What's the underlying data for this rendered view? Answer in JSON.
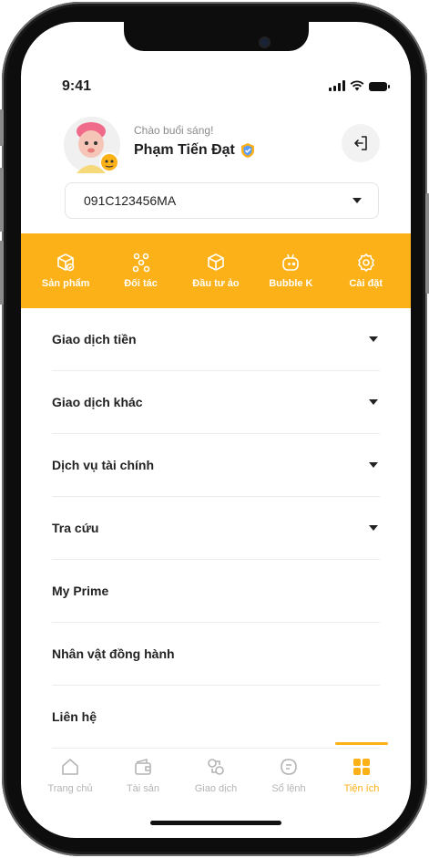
{
  "status_bar": {
    "time": "9:41"
  },
  "profile": {
    "greeting": "Chào buổi sáng!",
    "name": "Phạm Tiến Đạt"
  },
  "account": {
    "selected": "091C123456MA"
  },
  "quick_actions": [
    {
      "label": "Sản phẩm",
      "icon": "package-icon"
    },
    {
      "label": "Đối tác",
      "icon": "network-icon"
    },
    {
      "label": "Đầu tư ảo",
      "icon": "box-icon"
    },
    {
      "label": "Bubble K",
      "icon": "gamepad-icon"
    },
    {
      "label": "Cài đặt",
      "icon": "gear-icon"
    }
  ],
  "menu": [
    {
      "label": "Giao dịch tiền",
      "expandable": true
    },
    {
      "label": "Giao dịch khác",
      "expandable": true
    },
    {
      "label": "Dịch vụ tài chính",
      "expandable": true
    },
    {
      "label": "Tra cứu",
      "expandable": true
    },
    {
      "label": "My Prime",
      "expandable": false
    },
    {
      "label": "Nhân vật đồng hành",
      "expandable": false
    },
    {
      "label": "Liên hệ",
      "expandable": false
    }
  ],
  "tabs": [
    {
      "label": "Trang chủ",
      "icon": "home-icon",
      "active": false
    },
    {
      "label": "Tài sản",
      "icon": "wallet-icon",
      "active": false
    },
    {
      "label": "Giao dịch",
      "icon": "trade-icon",
      "active": false
    },
    {
      "label": "Sổ lệnh",
      "icon": "orderbook-icon",
      "active": false
    },
    {
      "label": "Tiện ích",
      "icon": "grid-icon",
      "active": true
    }
  ],
  "colors": {
    "accent": "#fbb117",
    "inactive": "#b4b4b4",
    "verified": "#fbb117"
  }
}
